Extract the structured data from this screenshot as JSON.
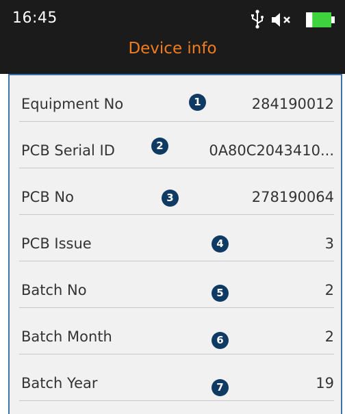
{
  "status_bar": {
    "time": "16:45",
    "icons": [
      "usb-icon",
      "mute-icon",
      "battery-icon"
    ],
    "battery_level": 0.75
  },
  "header": {
    "title": "Device info"
  },
  "colors": {
    "header_background": "#1b1b1b",
    "title": "#f07d1e",
    "frame": "#3a6fb0",
    "list_background": "#f1f1f1",
    "badge": "#0e3a64",
    "battery": "#3fd23f"
  },
  "rows": [
    {
      "label": "Equipment No",
      "value": "284190012",
      "badge": "1"
    },
    {
      "label": "PCB Serial ID",
      "value": "0A80C2043410...",
      "badge": "2"
    },
    {
      "label": "PCB No",
      "value": "278190064",
      "badge": "3"
    },
    {
      "label": "PCB Issue",
      "value": "3",
      "badge": "4"
    },
    {
      "label": "Batch No",
      "value": "2",
      "badge": "5"
    },
    {
      "label": "Batch Month",
      "value": "2",
      "badge": "6"
    },
    {
      "label": "Batch Year",
      "value": "19",
      "badge": "7"
    }
  ]
}
